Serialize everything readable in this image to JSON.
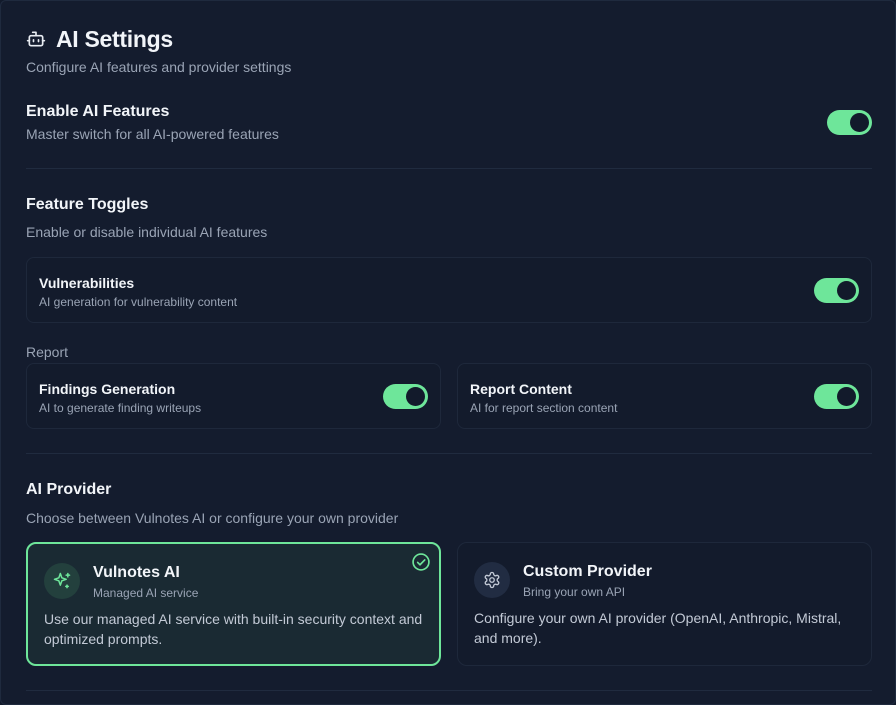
{
  "header": {
    "title": "AI Settings",
    "subtitle": "Configure AI features and provider settings",
    "icon": "bot-icon"
  },
  "master": {
    "title": "Enable AI Features",
    "description": "Master switch for all AI-powered features",
    "enabled": true
  },
  "feature_toggles": {
    "title": "Feature Toggles",
    "description": "Enable or disable individual AI features",
    "vulnerabilities": {
      "title": "Vulnerabilities",
      "description": "AI generation for vulnerability content",
      "enabled": true
    },
    "report_label": "Report",
    "findings": {
      "title": "Findings Generation",
      "description": "AI to generate finding writeups",
      "enabled": true
    },
    "report_content": {
      "title": "Report Content",
      "description": "AI for report section content",
      "enabled": true
    }
  },
  "provider": {
    "title": "AI Provider",
    "description": "Choose between Vulnotes AI or configure your own provider",
    "options": [
      {
        "name": "Vulnotes AI",
        "subtitle": "Managed AI service",
        "description": "Use our managed AI service with built-in security context and optimized prompts.",
        "icon": "sparkles-icon",
        "selected": true
      },
      {
        "name": "Custom Provider",
        "subtitle": "Bring your own API",
        "description": "Configure your own AI provider (OpenAI, Anthropic, Mistral, and more).",
        "icon": "gear-icon",
        "selected": false
      }
    ]
  },
  "colors": {
    "accent": "#6ee69a",
    "background": "#141c2e",
    "card": "#131b2c"
  }
}
